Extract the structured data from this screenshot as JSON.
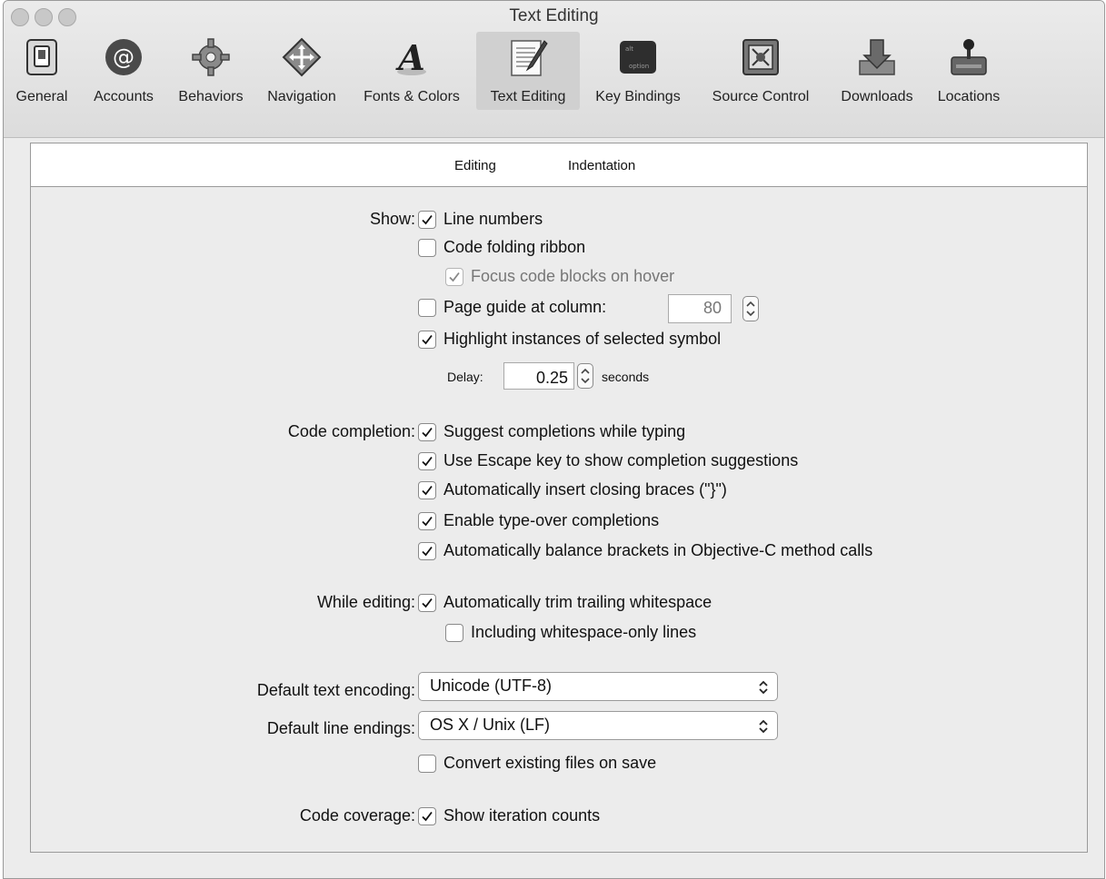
{
  "window": {
    "title": "Text Editing"
  },
  "toolbar": {
    "items": [
      {
        "label": "General",
        "icon": "switch-icon"
      },
      {
        "label": "Accounts",
        "icon": "at-sign-icon"
      },
      {
        "label": "Behaviors",
        "icon": "gear-icon"
      },
      {
        "label": "Navigation",
        "icon": "move-arrows-icon"
      },
      {
        "label": "Fonts & Colors",
        "icon": "font-a-icon"
      },
      {
        "label": "Text Editing",
        "icon": "pencil-document-icon",
        "selected": true
      },
      {
        "label": "Key Bindings",
        "icon": "option-key-icon"
      },
      {
        "label": "Source Control",
        "icon": "safe-icon"
      },
      {
        "label": "Downloads",
        "icon": "download-box-icon"
      },
      {
        "label": "Locations",
        "icon": "joystick-drive-icon"
      }
    ]
  },
  "tabs": [
    {
      "label": "Editing",
      "selected": false
    },
    {
      "label": "Indentation",
      "selected": true
    }
  ],
  "show": {
    "label": "Show:",
    "line_numbers": {
      "label": "Line numbers",
      "checked": true
    },
    "code_folding_ribbon": {
      "label": "Code folding ribbon",
      "checked": false
    },
    "focus_code_blocks": {
      "label": "Focus code blocks on hover",
      "checked": true,
      "enabled": false
    },
    "page_guide": {
      "label": "Page guide at column:",
      "checked": false,
      "value": "80"
    },
    "highlight_instances": {
      "label": "Highlight instances of selected symbol",
      "checked": true
    },
    "delay": {
      "label": "Delay:",
      "value": "0.25",
      "unit": "seconds"
    }
  },
  "code_completion": {
    "label": "Code completion:",
    "suggest": {
      "label": "Suggest completions while typing",
      "checked": true
    },
    "escape_key": {
      "label": "Use Escape key to show completion suggestions",
      "checked": true
    },
    "closing_braces": {
      "label": "Automatically insert closing braces (\"}\")",
      "checked": true
    },
    "type_over": {
      "label": "Enable type-over completions",
      "checked": true
    },
    "balance_brackets": {
      "label": "Automatically balance brackets in Objective-C method calls",
      "checked": true
    }
  },
  "while_editing": {
    "label": "While editing:",
    "trim_whitespace": {
      "label": "Automatically trim trailing whitespace",
      "checked": true
    },
    "whitespace_only": {
      "label": "Including whitespace-only lines",
      "checked": false
    }
  },
  "encoding": {
    "label": "Default text encoding:",
    "value": "Unicode (UTF-8)"
  },
  "line_endings": {
    "label": "Default line endings:",
    "value": "OS X / Unix (LF)",
    "convert": {
      "label": "Convert existing files on save",
      "checked": false
    }
  },
  "code_coverage": {
    "label": "Code coverage:",
    "iteration_counts": {
      "label": "Show iteration counts",
      "checked": true
    }
  }
}
